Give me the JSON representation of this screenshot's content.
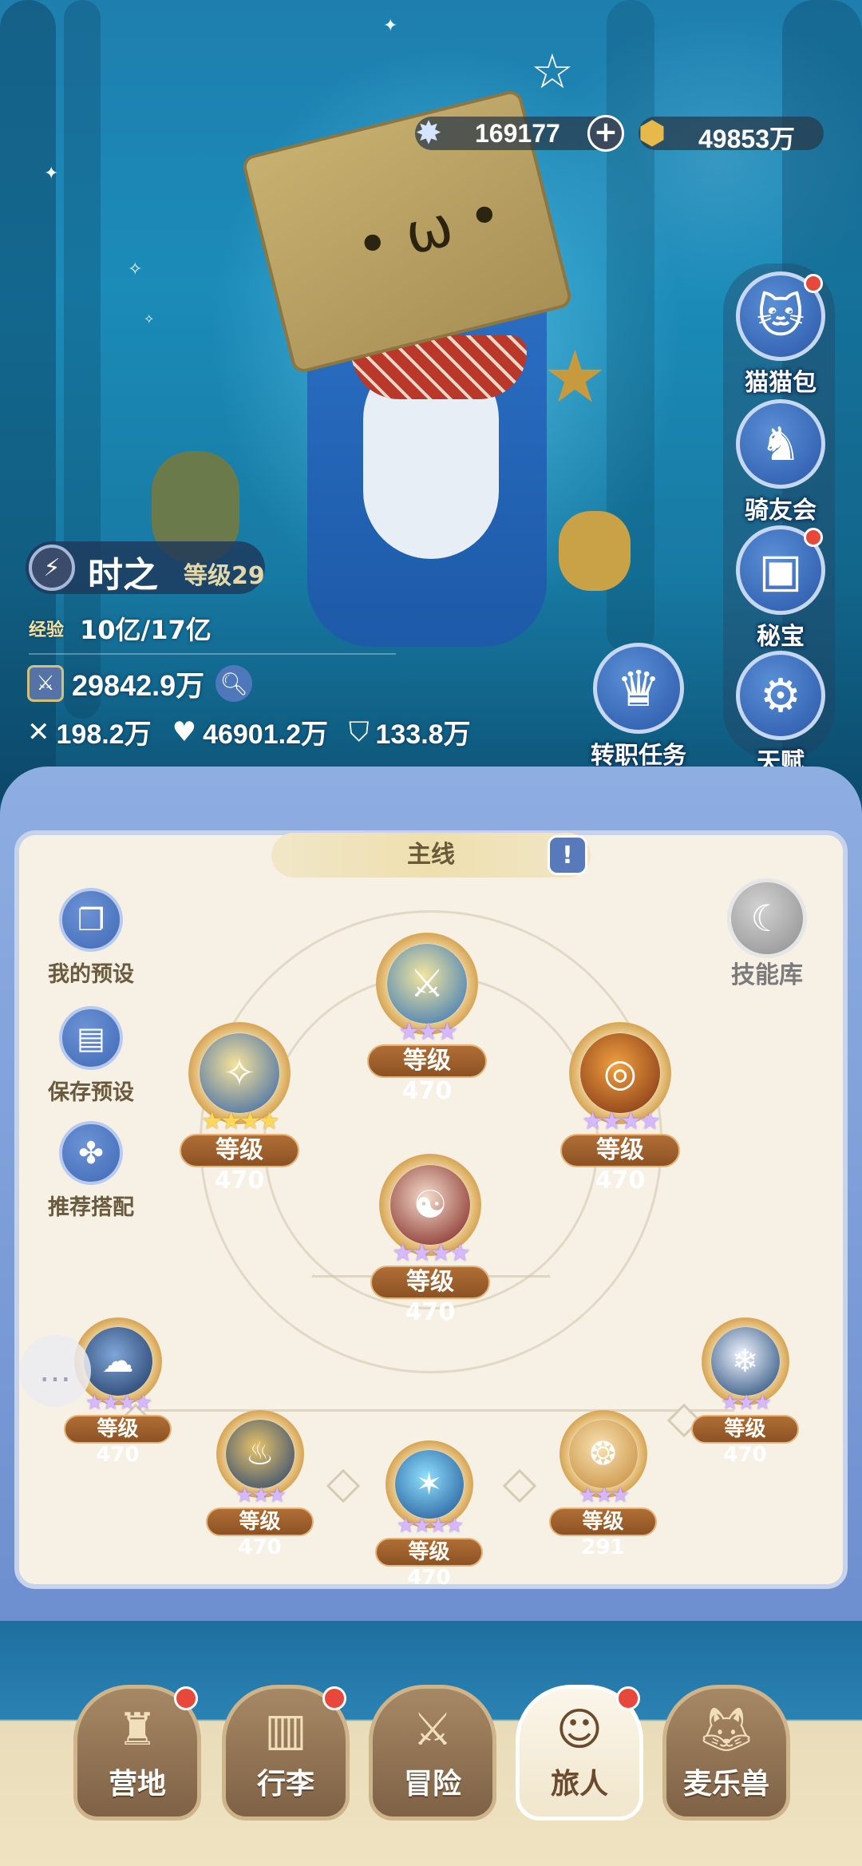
{
  "currency": {
    "diamond": {
      "value": "169177",
      "icon": "crystal-star-icon"
    },
    "gold": {
      "value": "49853万",
      "icon": "gold-coin-icon"
    }
  },
  "side_menu": [
    {
      "label": "猫猫包",
      "icon": "cat-bag-icon",
      "badge": true
    },
    {
      "label": "骑友会",
      "icon": "horse-icon",
      "badge": false
    },
    {
      "label": "秘宝",
      "icon": "treasure-chest-icon",
      "badge": true
    },
    {
      "label": "天赋",
      "icon": "head-gear-icon",
      "badge": false
    }
  ],
  "job_quest": {
    "label": "转职任务",
    "icon": "crown-icon"
  },
  "player": {
    "name": "时之",
    "level": "等级29",
    "exp_label": "经验",
    "exp": "10亿/17亿",
    "power": "29842.9万",
    "attack": "198.2万",
    "hp": "46901.2万",
    "defense": "133.8万"
  },
  "panel": {
    "tab": "主线",
    "tools": [
      "我的预设",
      "保存预设",
      "推荐搭配"
    ],
    "skill_library": "技能库"
  },
  "skills": [
    {
      "level": "等级470",
      "stars": "★★★",
      "star_color": "purple",
      "colors": [
        "#2a6fb8",
        "#f3e6a0"
      ]
    },
    {
      "level": "等级470",
      "stars": "★★★★",
      "star_color": "gold",
      "colors": [
        "#2c5fa8",
        "#f7e39a"
      ]
    },
    {
      "level": "等级470",
      "stars": "★★★★",
      "star_color": "purple",
      "colors": [
        "#7a2f12",
        "#f0a040"
      ]
    },
    {
      "level": "等级470",
      "stars": "★★★★",
      "star_color": "purple",
      "colors": [
        "#7a1c18",
        "#f4dccb"
      ]
    },
    {
      "level": "等级470",
      "stars": "★★★★",
      "star_color": "purple",
      "colors": [
        "#1e3660",
        "#7ea6d8"
      ]
    },
    {
      "level": "等级470",
      "stars": "★★★",
      "star_color": "purple",
      "colors": [
        "#1f3e70",
        "#e7c36a"
      ]
    },
    {
      "level": "等级470",
      "stars": "★★★★",
      "star_color": "purple",
      "colors": [
        "#1a4f8f",
        "#8fe0ff"
      ]
    },
    {
      "level": "等级291",
      "stars": "★★★",
      "star_color": "purple",
      "colors": [
        "#c48838",
        "#f8e2b2"
      ]
    },
    {
      "level": "等级470",
      "stars": "★★★",
      "star_color": "purple",
      "colors": [
        "#16406f",
        "#f1f4ff"
      ]
    }
  ],
  "nav": [
    {
      "label": "营地",
      "icon": "castle-icon",
      "badge": true,
      "active": false
    },
    {
      "label": "行李",
      "icon": "backpack-icon",
      "badge": true,
      "active": false
    },
    {
      "label": "冒险",
      "icon": "crossed-swords-icon",
      "badge": false,
      "active": false
    },
    {
      "label": "旅人",
      "icon": "traveler-portrait-icon",
      "badge": true,
      "active": true
    },
    {
      "label": "麦乐兽",
      "icon": "fox-pet-icon",
      "badge": false,
      "active": false
    }
  ]
}
